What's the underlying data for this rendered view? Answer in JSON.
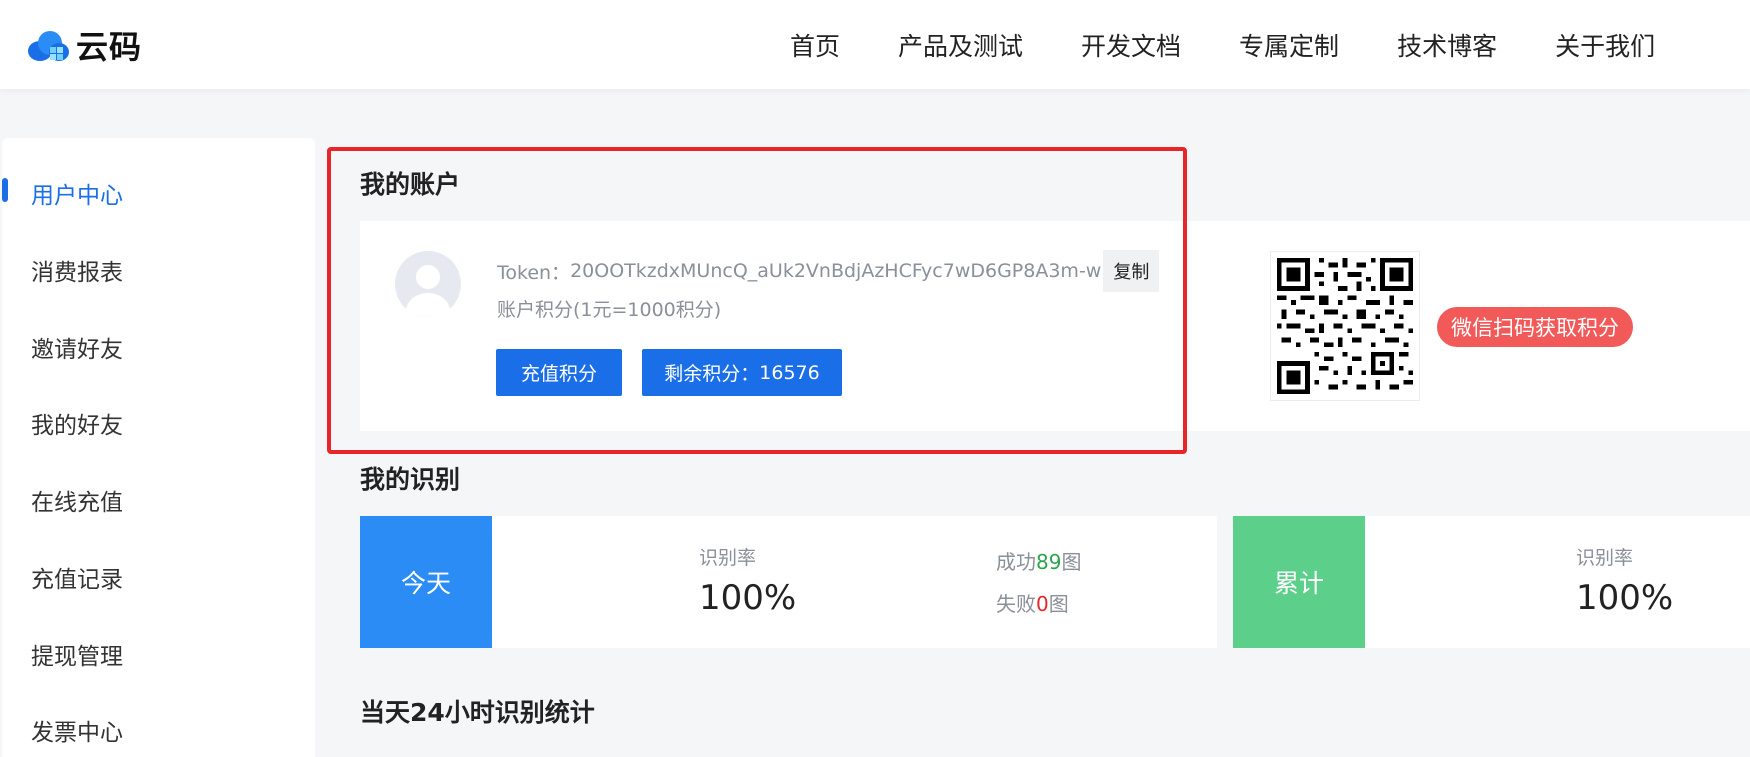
{
  "header": {
    "logo_text": "云码",
    "nav": [
      "首页",
      "产品及测试",
      "开发文档",
      "专属定制",
      "技术博客",
      "关于我们"
    ]
  },
  "sidebar": {
    "items": [
      {
        "label": "用户中心",
        "active": true
      },
      {
        "label": "消费报表"
      },
      {
        "label": "邀请好友"
      },
      {
        "label": "我的好友"
      },
      {
        "label": "在线充值"
      },
      {
        "label": "充值记录"
      },
      {
        "label": "提现管理"
      },
      {
        "label": "发票中心"
      }
    ]
  },
  "account": {
    "title": "我的账户",
    "token_label": "Token：",
    "token_value": "20OOTkzdxMUncQ_aUk2VnBdjAzHCFyc7wD6GP8A3m-w",
    "copy_label": "复制",
    "points_rate": "账户积分(1元=1000积分)",
    "recharge_label": "充值积分",
    "remaining_label": "剩余积分：",
    "remaining_value": "16576",
    "wechat_badge": "微信扫码获取积分"
  },
  "recognition": {
    "title": "我的识别",
    "today": {
      "label": "今天",
      "rate_label": "识别率",
      "rate_value": "100%",
      "success_prefix": "成功",
      "success_count": "89",
      "success_suffix": "图",
      "fail_prefix": "失败",
      "fail_count": "0",
      "fail_suffix": "图"
    },
    "total": {
      "label": "累计",
      "rate_label": "识别率",
      "rate_value": "100%"
    }
  },
  "stats24": {
    "title": "当天24小时识别统计"
  },
  "colors": {
    "primary": "#1a6fe8",
    "today_block": "#2b8cf6",
    "total_block": "#5ccf8b",
    "highlight": "#e8262a",
    "badge": "#f25a5a"
  }
}
